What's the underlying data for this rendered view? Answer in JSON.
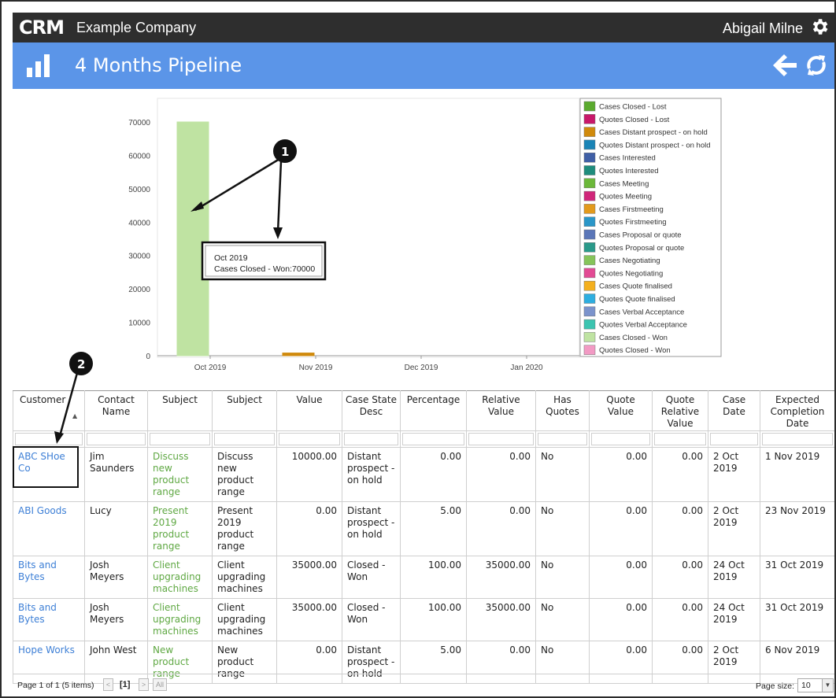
{
  "app": {
    "logo": "CRM",
    "company": "Example Company",
    "user": "Abigail Milne",
    "icons": {
      "settings": "gear-icon",
      "chart": "bar-chart-icon",
      "back": "arrow-left-icon",
      "refresh": "refresh-icon"
    }
  },
  "page": {
    "title": "4 Months Pipeline"
  },
  "chart_data": {
    "type": "bar",
    "categories": [
      "Oct 2019",
      "Nov 2019",
      "Dec 2019",
      "Jan 2020"
    ],
    "y_ticks": [
      "0",
      "10000",
      "20000",
      "30000",
      "40000",
      "50000",
      "60000",
      "70000"
    ],
    "ylim": [
      0,
      70000
    ],
    "legend_position": "right",
    "series": [
      {
        "name": "Cases Closed - Lost",
        "color": "#5aaa2e",
        "values": [
          0,
          0,
          0,
          0
        ]
      },
      {
        "name": "Quotes Closed - Lost",
        "color": "#c8186a",
        "values": [
          0,
          0,
          0,
          0
        ]
      },
      {
        "name": "Cases Distant prospect - on hold",
        "color": "#d08a0c",
        "values": [
          0,
          800,
          0,
          0
        ]
      },
      {
        "name": "Quotes Distant prospect - on hold",
        "color": "#1a84b6",
        "values": [
          0,
          0,
          0,
          0
        ]
      },
      {
        "name": "Cases Interested",
        "color": "#3f5fa6",
        "values": [
          0,
          0,
          0,
          0
        ]
      },
      {
        "name": "Quotes Interested",
        "color": "#1e8c7c",
        "values": [
          0,
          0,
          0,
          0
        ]
      },
      {
        "name": "Cases Meeting",
        "color": "#6cb83a",
        "values": [
          0,
          0,
          0,
          0
        ]
      },
      {
        "name": "Quotes Meeting",
        "color": "#d0267a",
        "values": [
          0,
          0,
          0,
          0
        ]
      },
      {
        "name": "Cases Firstmeeting",
        "color": "#e39a1c",
        "values": [
          0,
          0,
          0,
          0
        ]
      },
      {
        "name": "Quotes Firstmeeting",
        "color": "#2a96c8",
        "values": [
          0,
          0,
          0,
          0
        ]
      },
      {
        "name": "Cases Proposal or quote",
        "color": "#5a76b8",
        "values": [
          0,
          0,
          0,
          0
        ]
      },
      {
        "name": "Quotes Proposal or quote",
        "color": "#2a9a8a",
        "values": [
          0,
          0,
          0,
          0
        ]
      },
      {
        "name": "Cases Negotiating",
        "color": "#86c45a",
        "values": [
          0,
          0,
          0,
          0
        ]
      },
      {
        "name": "Quotes Negotiating",
        "color": "#e24a94",
        "values": [
          0,
          0,
          0,
          0
        ]
      },
      {
        "name": "Cases Quote finalised",
        "color": "#f4b01e",
        "values": [
          0,
          0,
          0,
          0
        ]
      },
      {
        "name": "Quotes Quote finalised",
        "color": "#2eaee0",
        "values": [
          0,
          0,
          0,
          0
        ]
      },
      {
        "name": "Cases Verbal Acceptance",
        "color": "#7b93cc",
        "values": [
          0,
          0,
          0,
          0
        ]
      },
      {
        "name": "Quotes Verbal Acceptance",
        "color": "#3cc4b0",
        "values": [
          0,
          0,
          0,
          0
        ]
      },
      {
        "name": "Cases Closed - Won",
        "color": "#bfe3a2",
        "values": [
          70000,
          0,
          0,
          0
        ]
      },
      {
        "name": "Quotes Closed - Won",
        "color": "#f29ac4",
        "values": [
          0,
          0,
          0,
          0
        ]
      }
    ],
    "tooltip": {
      "line1": "Oct 2019",
      "line2": "Cases Closed - Won:70000"
    },
    "annotations": [
      "1",
      "2"
    ]
  },
  "grid": {
    "columns": [
      {
        "label": "Customer",
        "align": "left"
      },
      {
        "label": "Contact Name"
      },
      {
        "label": "Subject"
      },
      {
        "label": "Subject"
      },
      {
        "label": "Value"
      },
      {
        "label": "Case State Desc"
      },
      {
        "label": "Percentage"
      },
      {
        "label": "Relative Value"
      },
      {
        "label": "Has Quotes"
      },
      {
        "label": "Quote Value"
      },
      {
        "label": "Quote Relative Value"
      },
      {
        "label": "Case Date"
      },
      {
        "label": "Expected Completion Date"
      }
    ],
    "sort_indicator": "▲",
    "rows": [
      {
        "customer": "ABC SHoe Co",
        "contact": "Jim Saunders",
        "subject_link": "Discuss new product range",
        "subject": "Discuss new product range",
        "value": "10000.00",
        "state": "Distant prospect - on hold",
        "percentage": "0.00",
        "relative_value": "0.00",
        "has_quotes": "No",
        "quote_value": "0.00",
        "quote_relative_value": "0.00",
        "case_date": "2 Oct 2019",
        "completion_date": "1 Nov 2019"
      },
      {
        "customer": "ABI Goods",
        "contact": "Lucy",
        "subject_link": "Present 2019 product range",
        "subject": "Present 2019 product range",
        "value": "0.00",
        "state": "Distant prospect - on hold",
        "percentage": "5.00",
        "relative_value": "0.00",
        "has_quotes": "No",
        "quote_value": "0.00",
        "quote_relative_value": "0.00",
        "case_date": "2 Oct 2019",
        "completion_date": "23 Nov 2019"
      },
      {
        "customer": "Bits and Bytes",
        "contact": "Josh Meyers",
        "subject_link": "Client upgrading machines",
        "subject": "Client upgrading machines",
        "value": "35000.00",
        "state": "Closed - Won",
        "percentage": "100.00",
        "relative_value": "35000.00",
        "has_quotes": "No",
        "quote_value": "0.00",
        "quote_relative_value": "0.00",
        "case_date": "24 Oct 2019",
        "completion_date": "31 Oct 2019"
      },
      {
        "customer": "Bits and Bytes",
        "contact": "Josh Meyers",
        "subject_link": "Client upgrading machines",
        "subject": "Client upgrading machines",
        "value": "35000.00",
        "state": "Closed - Won",
        "percentage": "100.00",
        "relative_value": "35000.00",
        "has_quotes": "No",
        "quote_value": "0.00",
        "quote_relative_value": "0.00",
        "case_date": "24 Oct 2019",
        "completion_date": "31 Oct 2019"
      },
      {
        "customer": "Hope Works",
        "contact": "John West",
        "subject_link": "New product range",
        "subject": "New product range",
        "value": "0.00",
        "state": "Distant prospect - on hold",
        "percentage": "5.00",
        "relative_value": "0.00",
        "has_quotes": "No",
        "quote_value": "0.00",
        "quote_relative_value": "0.00",
        "case_date": "2 Oct 2019",
        "completion_date": "6 Nov 2019"
      }
    ]
  },
  "pager": {
    "info": "Page 1 of 1 (5 items)",
    "prev": "<",
    "current": "[1]",
    "next": ">",
    "all": "All",
    "page_size_label": "Page size:",
    "page_size_value": "10"
  }
}
